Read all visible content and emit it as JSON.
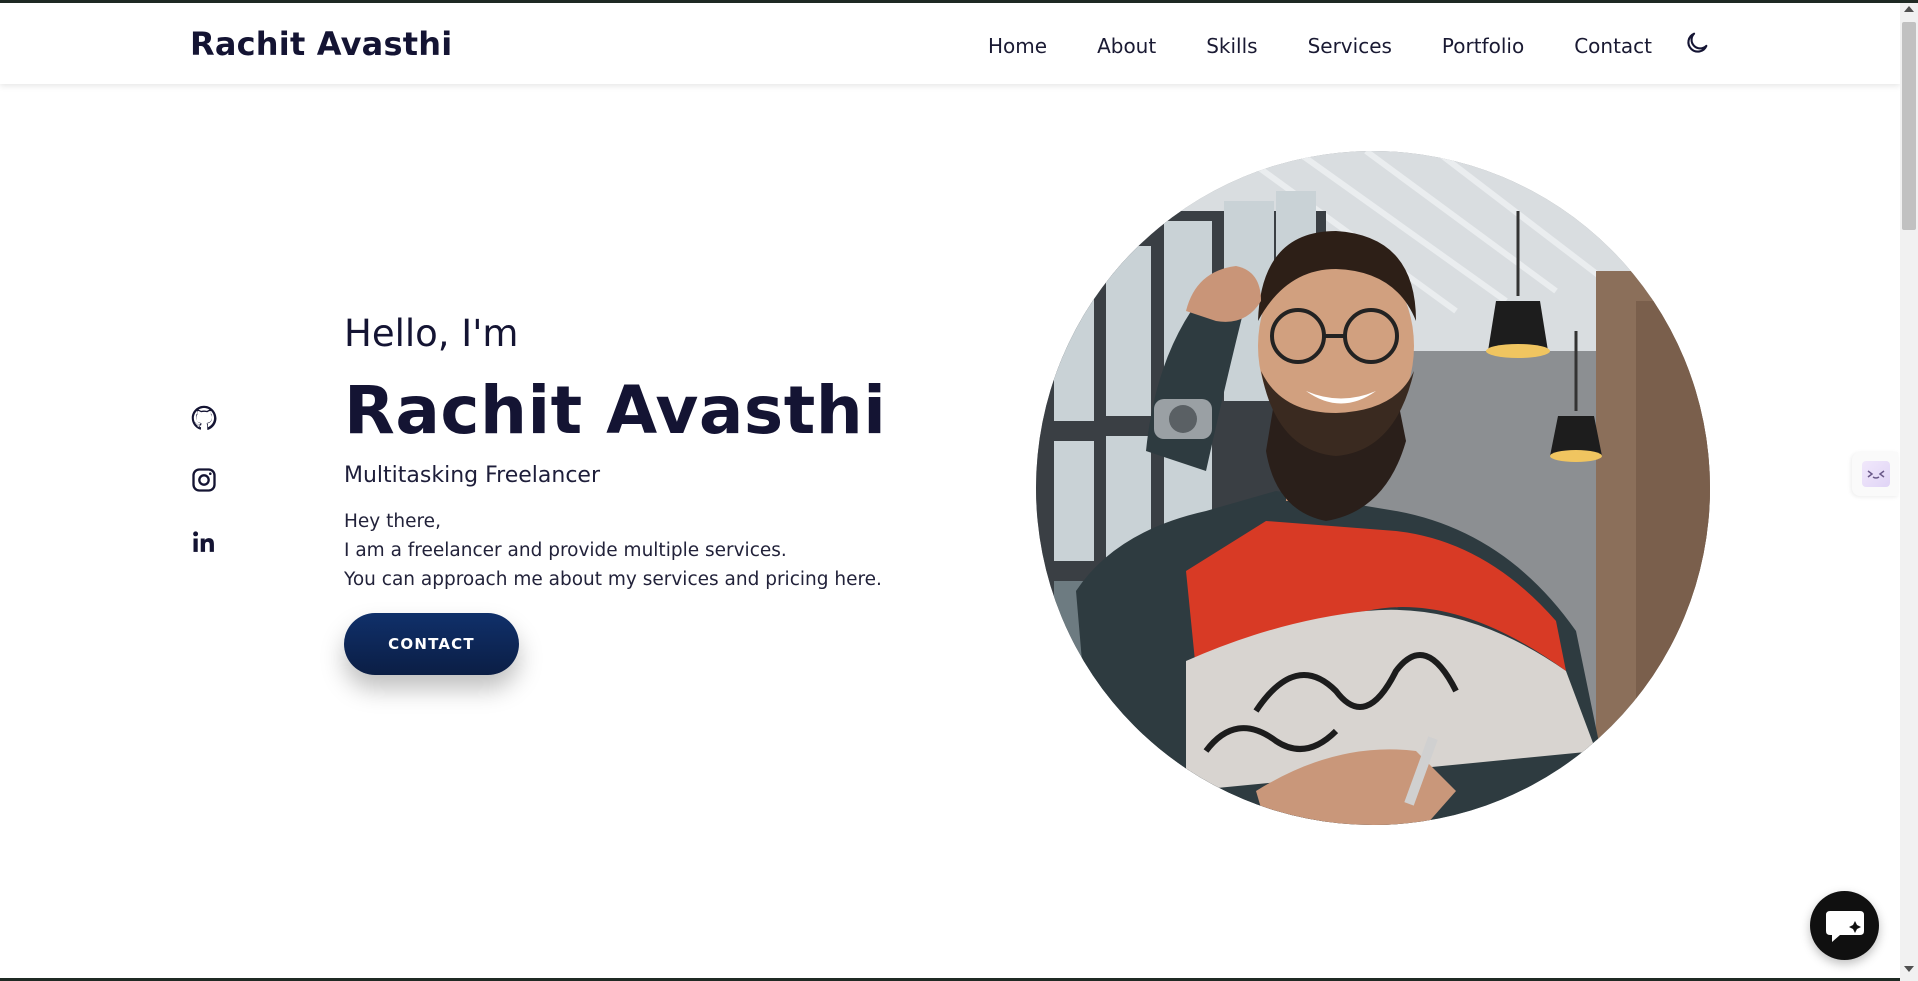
{
  "header": {
    "logo": "Rachit Avasthi",
    "nav": [
      "Home",
      "About",
      "Skills",
      "Services",
      "Portfolio",
      "Contact"
    ],
    "theme_toggle_icon": "moon-icon"
  },
  "social": [
    "github-icon",
    "instagram-icon",
    "linkedin-icon"
  ],
  "hero": {
    "greeting": "Hello, I'm",
    "name": "Rachit Avasthi",
    "tagline": "Multitasking Freelancer",
    "description": [
      "Hey there,",
      "I am a freelancer and provide multiple services.",
      "You can approach me about my services and pricing here."
    ],
    "cta_label": "CONTACT",
    "photo": "profile-photo"
  },
  "widgets": {
    "chat_icon": "chat-icon"
  },
  "colors": {
    "text_dark": "#141433",
    "button_navy": "#0f2a5e",
    "chat_bg": "#101010"
  }
}
